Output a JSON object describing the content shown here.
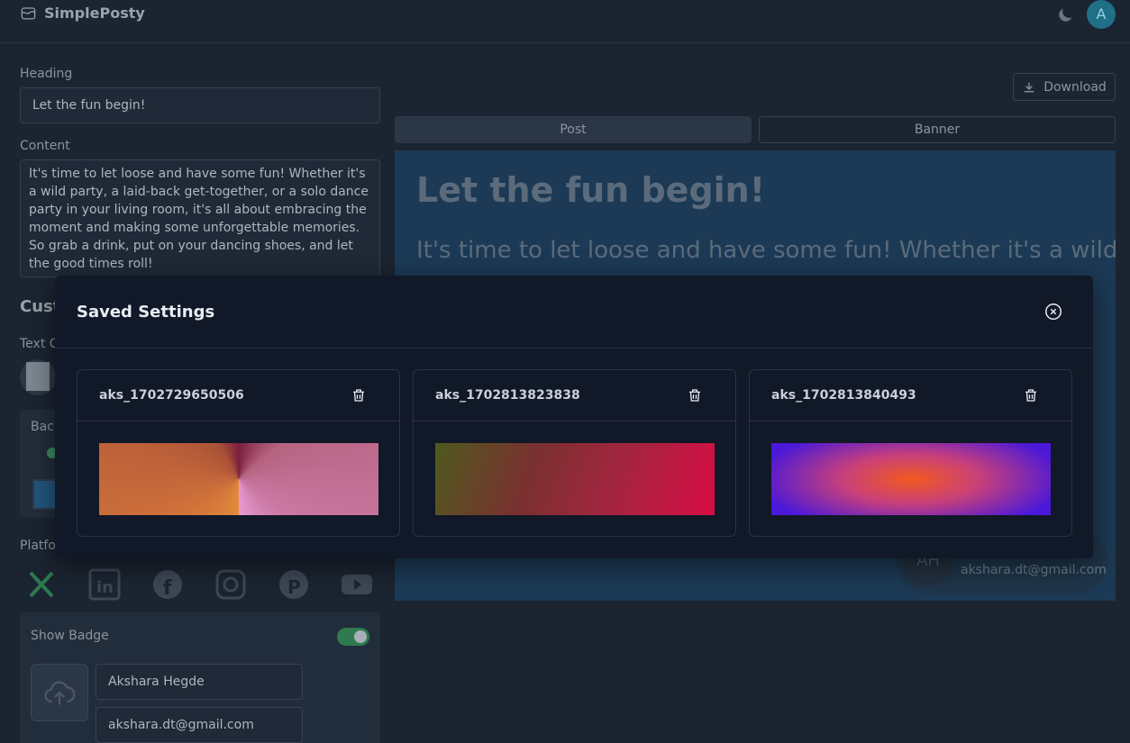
{
  "app": {
    "brand": "SimplePosty",
    "avatar_initial": "A"
  },
  "form": {
    "heading_label": "Heading",
    "heading_value": "Let the fun begin!",
    "content_label": "Content",
    "content_value": "It's time to let loose and have some fun! Whether it's a wild party, a laid-back get-together, or a solo dance party in your living room, it's all about embracing the moment and making some unforgettable memories. So grab a drink, put on your dancing shoes, and let the good times roll!",
    "customize_label_partial": "Cust",
    "text_color_label_partial": "Text C",
    "background_label_partial": "Back",
    "platform_label_partial": "Platfo",
    "show_badge_label": "Show Badge",
    "badge_name_value": "Akshara Hegde",
    "badge_email_value": "akshara.dt@gmail.com"
  },
  "preview": {
    "download_label": "Download",
    "tab_post": "Post",
    "tab_banner": "Banner",
    "title": "Let the fun begin!",
    "text_visible": "It's time to let loose and have some fun! Whether it's a wild",
    "badge_initials": "AH",
    "badge_email": "akshara.dt@gmail.com"
  },
  "modal": {
    "title": "Saved Settings",
    "items": [
      {
        "name": "aks_1702729650506"
      },
      {
        "name": "aks_1702813823838"
      },
      {
        "name": "aks_1702813840493"
      }
    ]
  },
  "colors": {
    "accent": "#1f6f86",
    "toggle_on": "#2f7a50",
    "modal_bg": "#111827"
  }
}
